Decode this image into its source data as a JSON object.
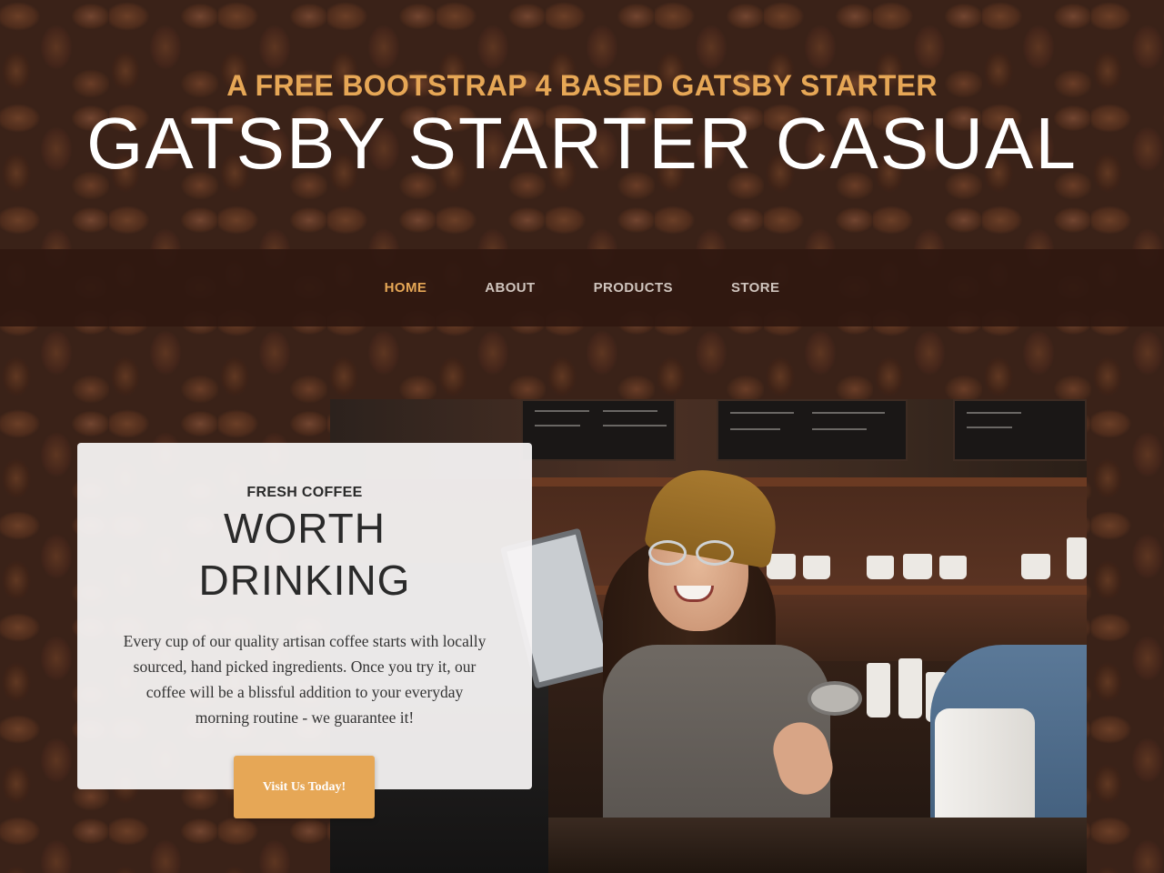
{
  "header": {
    "subtitle": "A FREE BOOTSTRAP 4 BASED GATSBY STARTER",
    "title": "GATSBY STARTER CASUAL"
  },
  "nav": {
    "items": [
      {
        "label": "HOME",
        "active": true
      },
      {
        "label": "ABOUT",
        "active": false
      },
      {
        "label": "PRODUCTS",
        "active": false
      },
      {
        "label": "STORE",
        "active": false
      }
    ]
  },
  "feature": {
    "eyebrow": "FRESH COFFEE",
    "heading_line1": "WORTH",
    "heading_line2": "DRINKING",
    "body": "Every cup of our quality artisan coffee starts with locally sourced, hand picked ingredients. Once you try it, our coffee will be a blissful addition to your everyday morning routine - we guarantee it!",
    "button_label": "Visit Us Today!",
    "image_description": "barista"
  },
  "colors": {
    "accent": "#e6a756",
    "nav_bg": "#2f1810",
    "card_bg": "#f7f4f4",
    "title_text": "#ffffff"
  }
}
